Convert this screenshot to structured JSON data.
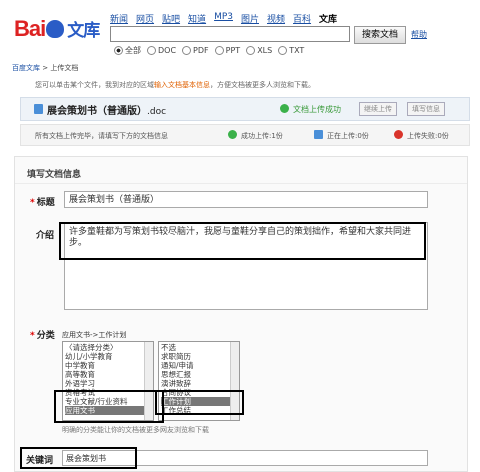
{
  "header": {
    "logo": {
      "left": "Bai",
      "right": "文库"
    },
    "nav": [
      "新闻",
      "网页",
      "贴吧",
      "知道",
      "MP3",
      "图片",
      "视频",
      "百科"
    ],
    "nav_current": "文库",
    "search_button": "搜索文档",
    "help_link": "帮助",
    "filters": [
      {
        "label": "全部",
        "selected": true
      },
      {
        "label": "DOC",
        "selected": false
      },
      {
        "label": "PDF",
        "selected": false
      },
      {
        "label": "PPT",
        "selected": false
      },
      {
        "label": "XLS",
        "selected": false
      },
      {
        "label": "TXT",
        "selected": false
      }
    ]
  },
  "breadcrumb": {
    "root": "百度文库",
    "sep": " > ",
    "current": "上传文档"
  },
  "tip": {
    "pre": "您可以单击某个文件，我到对应的区域",
    "highlight": "输入文档基本信息",
    "post": "，方便文档被更多人浏览和下载。"
  },
  "file": {
    "name": "展会策划书（普通版）",
    "ext": ".doc",
    "status": "文档上传成功",
    "continue_btn": "继续上传",
    "fill_btn": "填写信息"
  },
  "status_bar": {
    "message": "所有文档上传完毕，请填写下方的文档信息",
    "success": "成功上传:1份",
    "uploading": "正在上传:0份",
    "failed": "上传失败:0份",
    "colors": {
      "success": "#3bb14a",
      "uploading": "#4a8fd8",
      "failed": "#d9342b"
    }
  },
  "form": {
    "section_title": "填写文档信息",
    "title_label": "标题",
    "title_value": "展会策划书（普通版）",
    "intro_label": "介绍",
    "intro_value": "许多童鞋都为写策划书较尽脑汁，我愿与童鞋分享自己的策划拙作，希望和大家共同进步。",
    "category_label": "分类",
    "category_path": "应用文书->工作计划",
    "category_list_1": [
      "〈请选择分类〉",
      "幼儿/小学教育",
      "中学教育",
      "高等教育",
      "外语学习",
      "资格考试",
      "专业文献/行业资料",
      "应用文书"
    ],
    "category_list_1_selected": "应用文书",
    "category_list_2": [
      "不选",
      "求职简历",
      "通知/申请",
      "思想汇报",
      "演讲致辞",
      "合同协议",
      "工作计划",
      "工作总结"
    ],
    "category_list_2_selected": "工作计划",
    "category_hint": "明确的分类能让你的文档被更多网友浏览和下载",
    "keyword_label": "关键词",
    "keyword_value": "展会策划书"
  }
}
